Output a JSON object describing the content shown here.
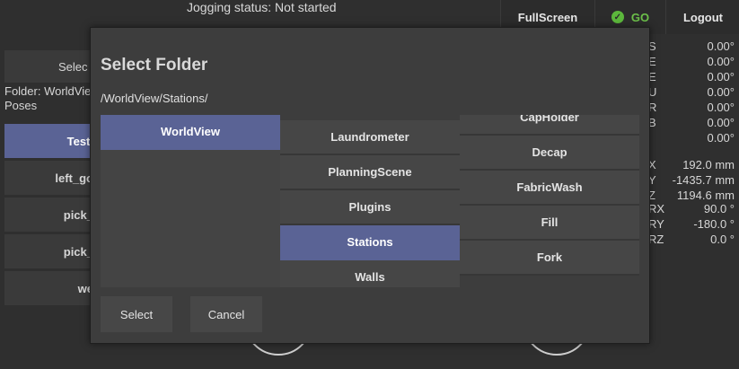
{
  "topbar": {
    "jogging_status": "Jogging status: Not started",
    "fullscreen_label": "FullScreen",
    "go_label": "GO",
    "logout_label": "Logout"
  },
  "left_panel": {
    "select_label": "Selec",
    "folder_label": "Folder: WorldVie",
    "folder_sub": "Poses",
    "items": [
      "TestI",
      "left_go",
      "pick_",
      "pick_",
      "we"
    ]
  },
  "readouts": {
    "joints": [
      "0.00°",
      "0.00°",
      "0.00°",
      "0.00°",
      "0.00°",
      "0.00°",
      "0.00°"
    ],
    "joint_letters": [
      "S",
      "E",
      "E",
      "U",
      "R",
      "B",
      ""
    ],
    "pose_labels": [
      "X",
      "Y",
      "Z",
      "RX",
      "RY",
      "RZ"
    ],
    "pose_values": [
      "192.0 mm",
      "-1435.7 mm",
      "1194.6 mm",
      "90.0 °",
      "-180.0 °",
      "0.0 °"
    ]
  },
  "dialog": {
    "title": "Select Folder",
    "path": "/WorldView/Stations/",
    "column1": [
      "WorldView"
    ],
    "column2": [
      "Laundrometer",
      "PlanningScene",
      "Plugins",
      "Stations",
      "Walls"
    ],
    "column3": [
      "CapHolder",
      "Decap",
      "FabricWash",
      "Fill",
      "Fork"
    ],
    "select_button": "Select",
    "cancel_button": "Cancel"
  },
  "colors": {
    "selected": "#5a6395",
    "go_green": "#5cb83c",
    "background": "#2f2f2f"
  }
}
